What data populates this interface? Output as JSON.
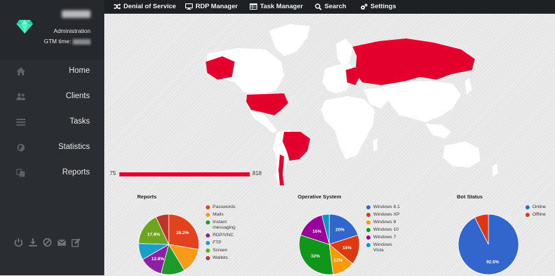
{
  "sidebar": {
    "role": "Administration",
    "gmt_label": "GTM time:",
    "items": [
      {
        "label": "Home",
        "icon": "home-icon"
      },
      {
        "label": "Clients",
        "icon": "users-icon"
      },
      {
        "label": "Tasks",
        "icon": "tasks-icon"
      },
      {
        "label": "Statistics",
        "icon": "globe-icon"
      },
      {
        "label": "Reports",
        "icon": "copy-icon"
      }
    ],
    "bottom_icons": [
      "power-icon",
      "download-icon",
      "ban-icon",
      "envelope-icon",
      "edit-icon"
    ]
  },
  "topbar": {
    "items": [
      {
        "label": "Denial of Service",
        "icon": "shuffle-icon"
      },
      {
        "label": "RDP Manager",
        "icon": "monitor-icon"
      },
      {
        "label": "Task Manager",
        "icon": "table-icon"
      },
      {
        "label": "Search",
        "icon": "search-icon"
      },
      {
        "label": "Settings",
        "icon": "cogs-icon"
      }
    ]
  },
  "map": {
    "legend_min": "75",
    "legend_max": "818",
    "highlight_color": "#e3002c",
    "land_color": "#ffffff"
  },
  "chart_data": [
    {
      "type": "pie",
      "title": "Reports",
      "categories": [
        "Passwords",
        "Mails",
        "Instant messaging",
        "RDP/VNC",
        "FTP",
        "Screen",
        "Wallets"
      ],
      "values": [
        28.2,
        14.0,
        13.0,
        12.8,
        9.0,
        17.9,
        7.1
      ],
      "colors": [
        "#e2431e",
        "#f79a18",
        "#1e9a2a",
        "#8e1fa7",
        "#1aa0c8",
        "#6fa51e",
        "#c0332a"
      ],
      "labels": [
        "28.2%",
        "",
        "",
        "12.8%",
        "",
        "17.9%",
        ""
      ]
    },
    {
      "type": "pie",
      "title": "Operative System",
      "categories": [
        "Windows 8.1",
        "Windows XP",
        "Windows 8",
        "Windows 10",
        "Windows 7",
        "Windows Vista"
      ],
      "values": [
        20,
        16,
        12,
        32,
        16,
        4
      ],
      "colors": [
        "#3366cc",
        "#dc3912",
        "#ff9900",
        "#109618",
        "#990099",
        "#0099c6"
      ],
      "labels": [
        "20%",
        "16%",
        "12%",
        "32%",
        "16%",
        ""
      ]
    },
    {
      "type": "pie",
      "title": "Bot Status",
      "categories": [
        "Online",
        "Offline"
      ],
      "values": [
        92.5,
        7.5
      ],
      "colors": [
        "#3366cc",
        "#dc3912"
      ],
      "labels": [
        "92.5%",
        ""
      ]
    }
  ]
}
